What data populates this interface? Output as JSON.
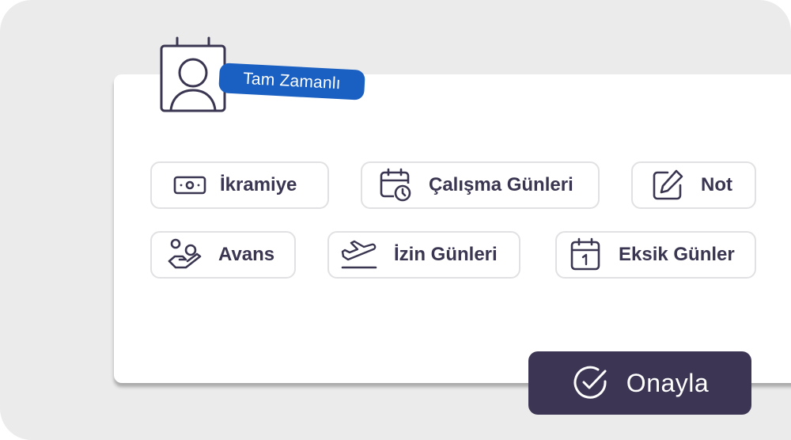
{
  "employee": {
    "status_badge": "Tam Zamanlı",
    "avatar_icon": "user-calendar-icon"
  },
  "actions": [
    {
      "label": "İkramiye",
      "icon": "banknote-icon"
    },
    {
      "label": "Çalışma Günleri",
      "icon": "calendar-clock-icon"
    },
    {
      "label": "Not",
      "icon": "edit-note-icon"
    },
    {
      "label": "Avans",
      "icon": "hand-money-icon"
    },
    {
      "label": "İzin Günleri",
      "icon": "airplane-takeoff-icon"
    },
    {
      "label": "Eksik Günler",
      "icon": "calendar-day-icon"
    }
  ],
  "confirm": {
    "label": "Onayla",
    "icon": "check-circle-icon"
  },
  "colors": {
    "background": "#ebebeb",
    "card": "#ffffff",
    "badge": "#1a5fc2",
    "primary_dark": "#3d3554",
    "text": "#3a3550",
    "chip_border": "#e1e1e4"
  }
}
